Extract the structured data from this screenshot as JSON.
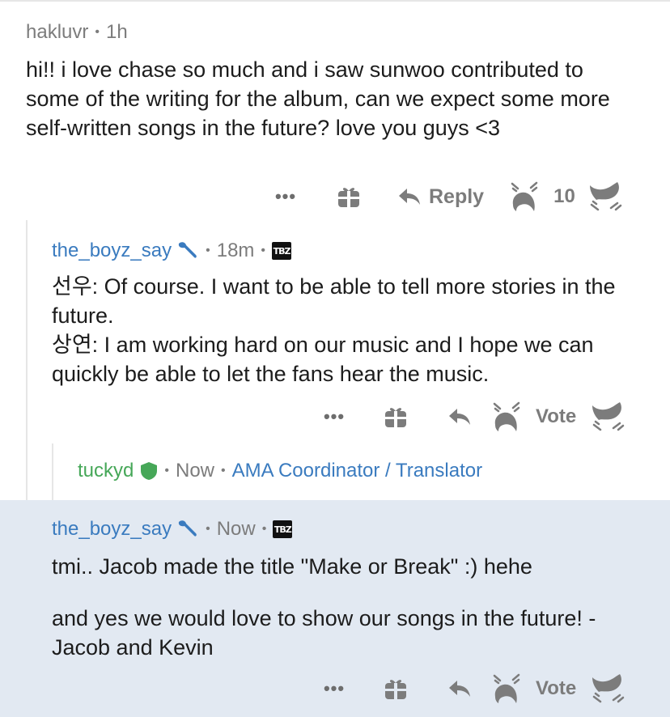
{
  "comment1": {
    "username": "hakluvr",
    "time": "1h",
    "body": "hi!! i love chase so much and i saw sunwoo contributed to some of the writing for the album, can we expect some more self-written songs in the future? love you guys <3",
    "actions": {
      "more": "•••",
      "reply_label": "Reply",
      "score": "10"
    }
  },
  "comment2": {
    "username": "the_boyz_say",
    "time": "18m",
    "badge": "TBZ",
    "lines": [
      "선우: Of course. I want to be able to tell more stories in the future.",
      "상연: I am working hard on our music and I hope we can quickly be able to let the fans hear the music."
    ],
    "actions": {
      "more": "•••",
      "vote_label": "Vote"
    }
  },
  "comment3": {
    "username": "tuckyd",
    "time": "Now",
    "flair": "AMA Coordinator / Translator"
  },
  "comment4": {
    "username": "the_boyz_say",
    "time": "Now",
    "badge": "TBZ",
    "para1": "tmi.. Jacob made the title \"Make or Break\" :) hehe",
    "para2": "and yes we would love to show our songs in the future! - Jacob and Kevin",
    "actions": {
      "more": "•••",
      "vote_label": "Vote"
    }
  },
  "colors": {
    "username_blue": "#3a7bbf",
    "mod_green": "#46a758",
    "highlight_bg": "#e2e9f2",
    "meta_gray": "#7c7c7c"
  },
  "icons": [
    "gift-icon",
    "reply-arrow-icon",
    "upvote-icon",
    "downvote-icon",
    "wrench-icon",
    "shield-icon"
  ]
}
